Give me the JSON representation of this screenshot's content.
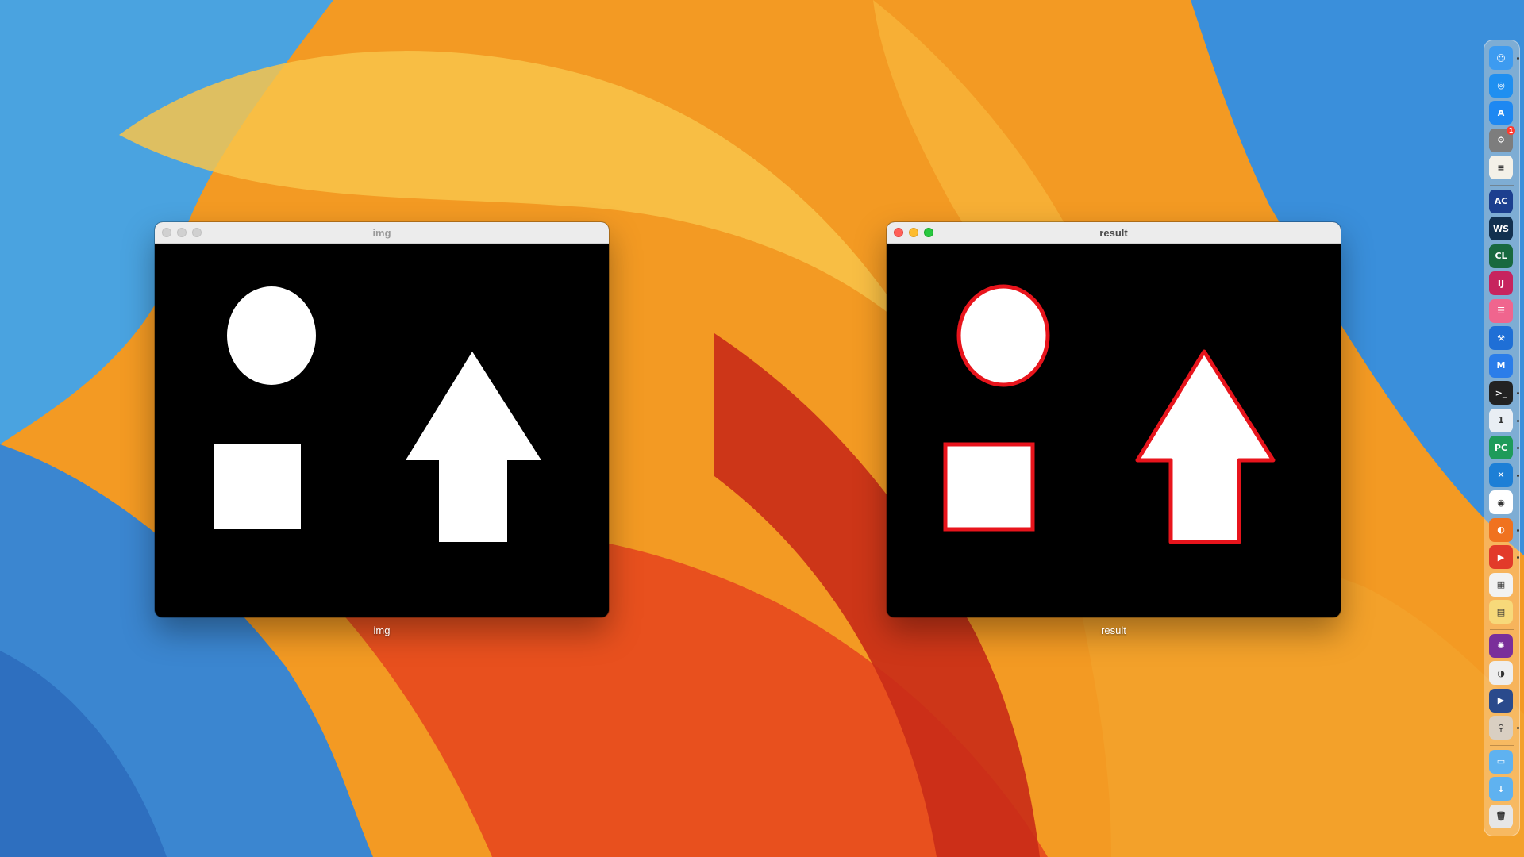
{
  "windows": [
    {
      "title": "img",
      "label": "img",
      "active": false
    },
    {
      "title": "result",
      "label": "result",
      "active": true
    }
  ],
  "colors": {
    "outline": "#e8141c",
    "shape_fill": "#ffffff",
    "canvas_bg": "#000000"
  },
  "dock": {
    "items": [
      {
        "name": "finder-icon",
        "glyph": "☺",
        "bg": "#3d9bf0",
        "running": true
      },
      {
        "name": "safari-icon",
        "glyph": "◎",
        "bg": "#1f8ff0",
        "running": false
      },
      {
        "name": "app-store-icon",
        "glyph": "A",
        "bg": "#1e88f2",
        "running": false
      },
      {
        "name": "system-settings-icon",
        "glyph": "⚙",
        "bg": "#7d7d7d",
        "running": false,
        "badge": "1"
      },
      {
        "name": "notes-icon",
        "glyph": "≡",
        "bg": "#f4f1e8",
        "running": false
      },
      {
        "name": "appcode-icon",
        "glyph": "AC",
        "bg": "#1c3f8f",
        "running": false
      },
      {
        "name": "webstorm-icon",
        "glyph": "WS",
        "bg": "#12304f",
        "running": false
      },
      {
        "name": "clion-icon",
        "glyph": "CL",
        "bg": "#18693f",
        "running": false
      },
      {
        "name": "intellij-icon",
        "glyph": "IJ",
        "bg": "#c7245e",
        "running": false
      },
      {
        "name": "books-icon",
        "glyph": "☰",
        "bg": "#f0658e",
        "running": false
      },
      {
        "name": "xcode-icon",
        "glyph": "⚒",
        "bg": "#1f6fd6",
        "running": false
      },
      {
        "name": "mindnode-icon",
        "glyph": "M",
        "bg": "#2b7de9",
        "running": false
      },
      {
        "name": "terminal-icon",
        "glyph": ">_",
        "bg": "#222222",
        "running": true
      },
      {
        "name": "1password-icon",
        "glyph": "1",
        "bg": "#e9eef4",
        "running": true
      },
      {
        "name": "pycharm-icon",
        "glyph": "PC",
        "bg": "#1e9b5a",
        "running": true
      },
      {
        "name": "vscode-icon",
        "glyph": "✕",
        "bg": "#1d7fd6",
        "running": true
      },
      {
        "name": "chrome-icon",
        "glyph": "◉",
        "bg": "#ffffff",
        "running": false
      },
      {
        "name": "firefox-icon",
        "glyph": "◐",
        "bg": "#f0721f",
        "running": true
      },
      {
        "name": "vlc-icon",
        "glyph": "▶",
        "bg": "#e23a2a",
        "running": true
      },
      {
        "name": "launchpad-icon",
        "glyph": "▦",
        "bg": "#f2f2f2",
        "running": false
      },
      {
        "name": "stickies-icon",
        "glyph": "▤",
        "bg": "#f7d97a",
        "running": false
      },
      {
        "name": "graphic-icon",
        "glyph": "✺",
        "bg": "#7a2f9a",
        "running": false
      },
      {
        "name": "toggle-icon",
        "glyph": "◑",
        "bg": "#eeeeee",
        "running": false
      },
      {
        "name": "player-icon",
        "glyph": "▶",
        "bg": "#2a4a8c",
        "running": false
      },
      {
        "name": "rocket-icon",
        "glyph": "⚲",
        "bg": "#d9cfc2",
        "running": true
      },
      {
        "name": "folder-icon",
        "glyph": "▭",
        "bg": "#5fb2f0",
        "running": false
      },
      {
        "name": "downloads-icon",
        "glyph": "↓",
        "bg": "#5fb2f0",
        "running": false
      },
      {
        "name": "trash-icon",
        "glyph": "🗑",
        "bg": "#e6e6e6",
        "running": false
      }
    ]
  }
}
